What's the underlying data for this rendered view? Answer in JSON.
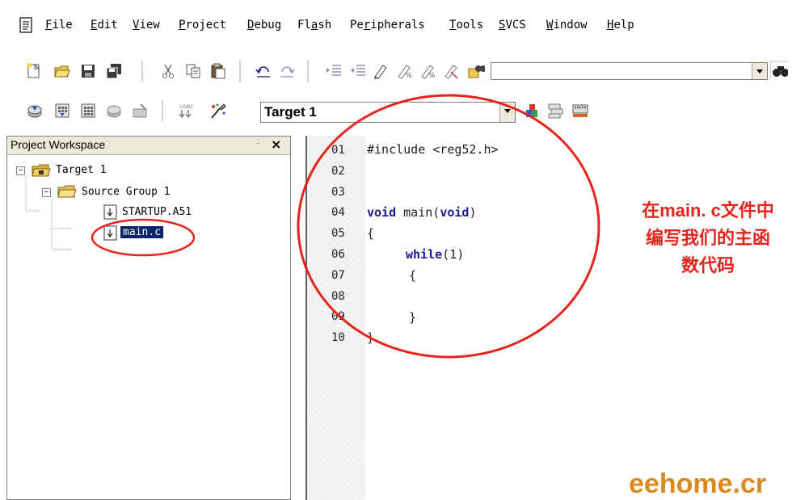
{
  "menu": {
    "items": [
      {
        "accel": "F",
        "rest": "ile"
      },
      {
        "accel": "E",
        "rest": "dit"
      },
      {
        "accel": "V",
        "rest": "iew"
      },
      {
        "accel": "P",
        "rest": "roject"
      },
      {
        "accel": "D",
        "rest": "ebug"
      },
      {
        "pre": "Fl",
        "accel": "a",
        "rest": "sh"
      },
      {
        "pre": "Pe",
        "accel": "r",
        "rest": "ipherals"
      },
      {
        "accel": "T",
        "rest": "ools"
      },
      {
        "accel": "S",
        "rest": "VCS"
      },
      {
        "accel": "W",
        "rest": "indow"
      },
      {
        "accel": "H",
        "rest": "elp"
      }
    ]
  },
  "toolbar2": {
    "target_value": "Target 1"
  },
  "project": {
    "title": "Project Workspace",
    "close_glyph": "×",
    "pin_glyph": "-",
    "target": "Target 1",
    "group": "Source Group 1",
    "files": [
      "STARTUP.A51",
      "main.c"
    ]
  },
  "editor": {
    "line_numbers": [
      "01",
      "02",
      "03",
      "04",
      "05",
      "06",
      "07",
      "08",
      "09",
      "10"
    ],
    "lines": {
      "l1": "#include <reg52.h>",
      "l4_kw1": "void",
      "l4_mid": " main(",
      "l4_kw2": "void",
      "l4_end": ")",
      "l5": "{",
      "l6_kw": "while",
      "l6_rest": "(1)",
      "l7": "{",
      "l9": "}",
      "l10": "}"
    }
  },
  "annotation": {
    "line1_pre": "在",
    "line1_bold": "main. c",
    "line1_post": "文件中",
    "line2": "编写我们的主函",
    "line3": "数代码",
    "color": "#e8231c"
  },
  "watermark": "eehome.cr"
}
